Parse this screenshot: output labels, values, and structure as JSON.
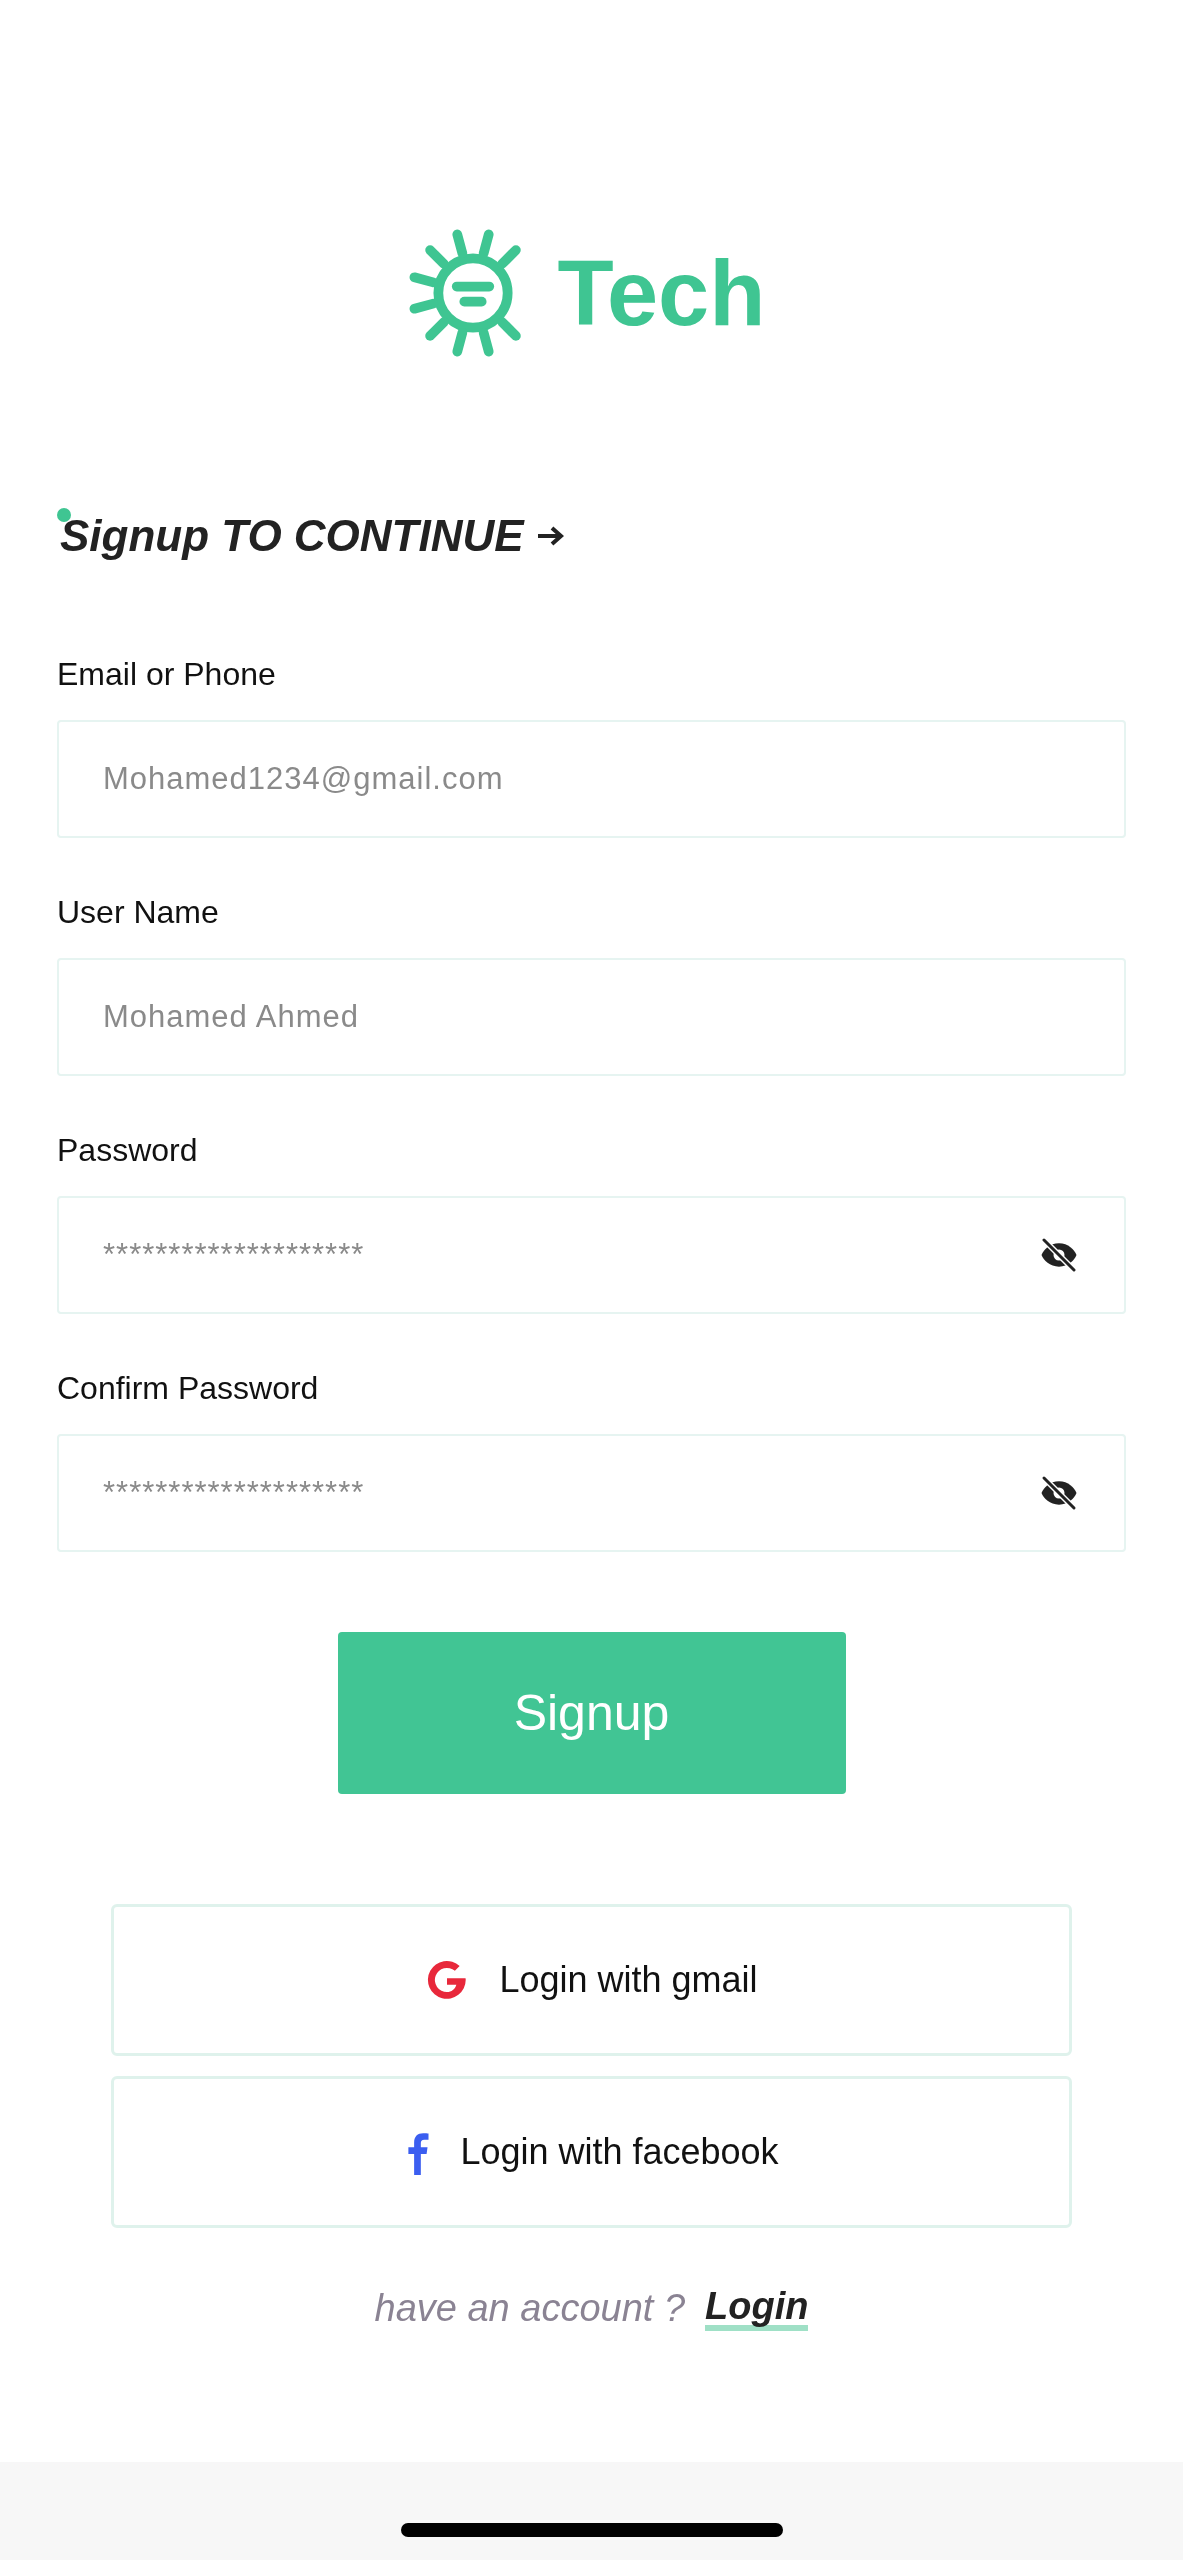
{
  "logo": {
    "text": "Tech"
  },
  "heading": {
    "text": "Signup TO CONTINUE"
  },
  "fields": [
    {
      "label": "Email or Phone",
      "placeholder": "Mohamed1234@gmail.com",
      "kind": "text"
    },
    {
      "label": "User Name",
      "placeholder": "Mohamed Ahmed",
      "kind": "text"
    },
    {
      "label": "Password",
      "placeholder": "********************",
      "kind": "password"
    },
    {
      "label": "Confirm Password",
      "placeholder": "********************",
      "kind": "password"
    }
  ],
  "signup_button": "Signup",
  "social_buttons": [
    {
      "label": "Login with gmail",
      "kind": "google"
    },
    {
      "label": "Login with facebook",
      "kind": "facebook"
    }
  ],
  "footer": {
    "prompt": "have an account ?",
    "link": "Login"
  }
}
